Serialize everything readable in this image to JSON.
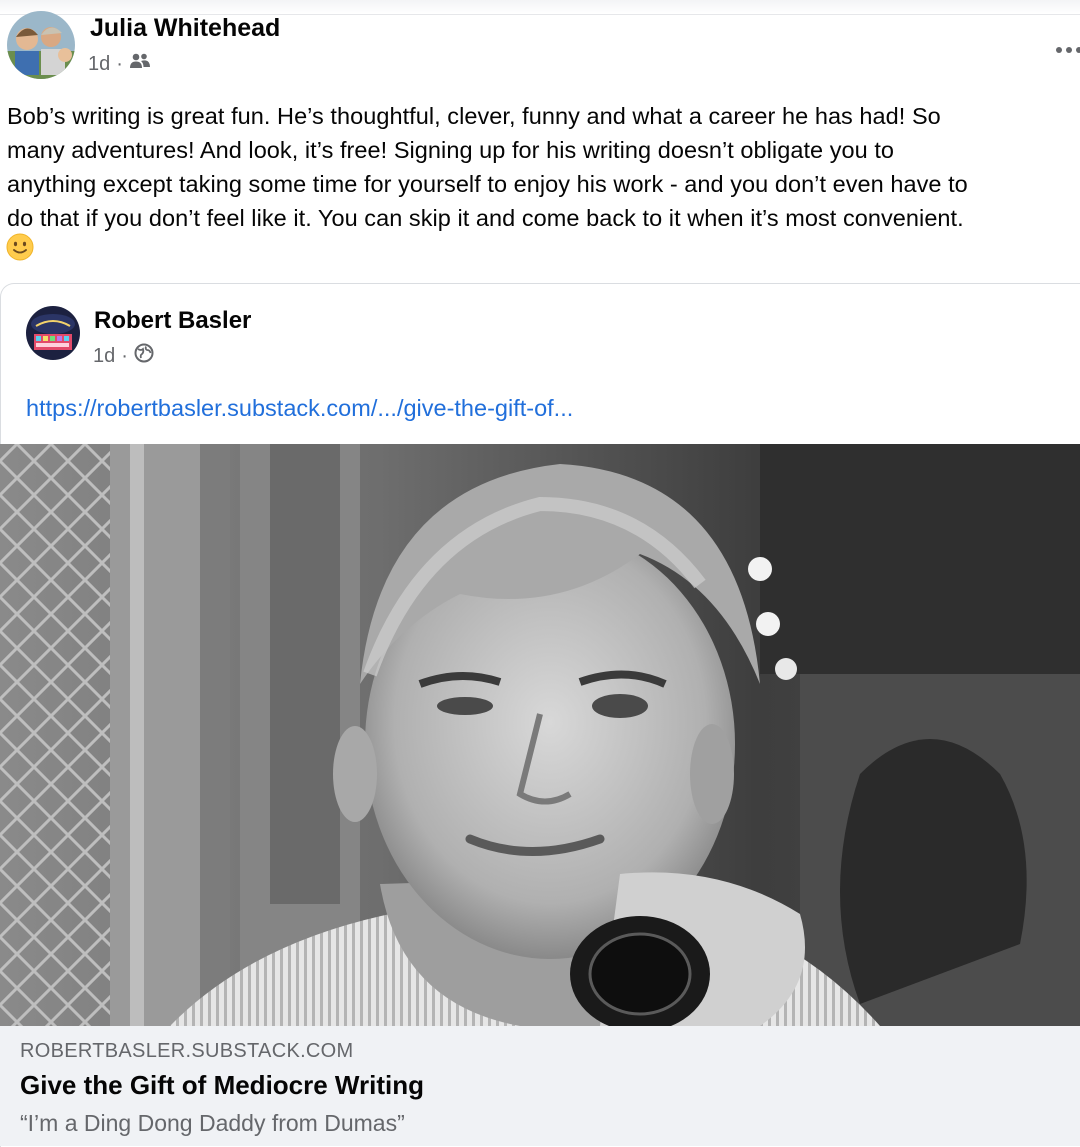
{
  "post": {
    "author": "Julia Whitehead",
    "time": "1d",
    "separator": "·",
    "audience_icon": "friends-icon",
    "more_icon": "more-options-icon",
    "text": "Bob’s writing is great fun. He’s thoughtful, clever, funny and what a career he has had! So\nmany adventures! And look, it’s free! Signing up for his writing doesn’t obligate you to\nanything except taking some time for yourself to enjoy his work - and you don’t even have to\ndo that if you don’t feel like it. You can skip it and come back to it when it’s most convenient.",
    "emoji": "slightly-smiling-face"
  },
  "shared_post": {
    "author": "Robert Basler",
    "time": "1d",
    "separator": "·",
    "audience_icon": "globe-icon",
    "link": "https://robertbasler.substack.com/.../give-the-gift-of...",
    "link_preview": {
      "domain": "ROBERTBASLER.SUBSTACK.COM",
      "title": "Give the Gift of Mediocre Writing",
      "subtitle": "“I’m a Ding Dong Daddy from Dumas”"
    }
  },
  "colors": {
    "link": "#216fdb",
    "secondary_text": "#65676b",
    "preview_background": "#f0f2f5"
  }
}
